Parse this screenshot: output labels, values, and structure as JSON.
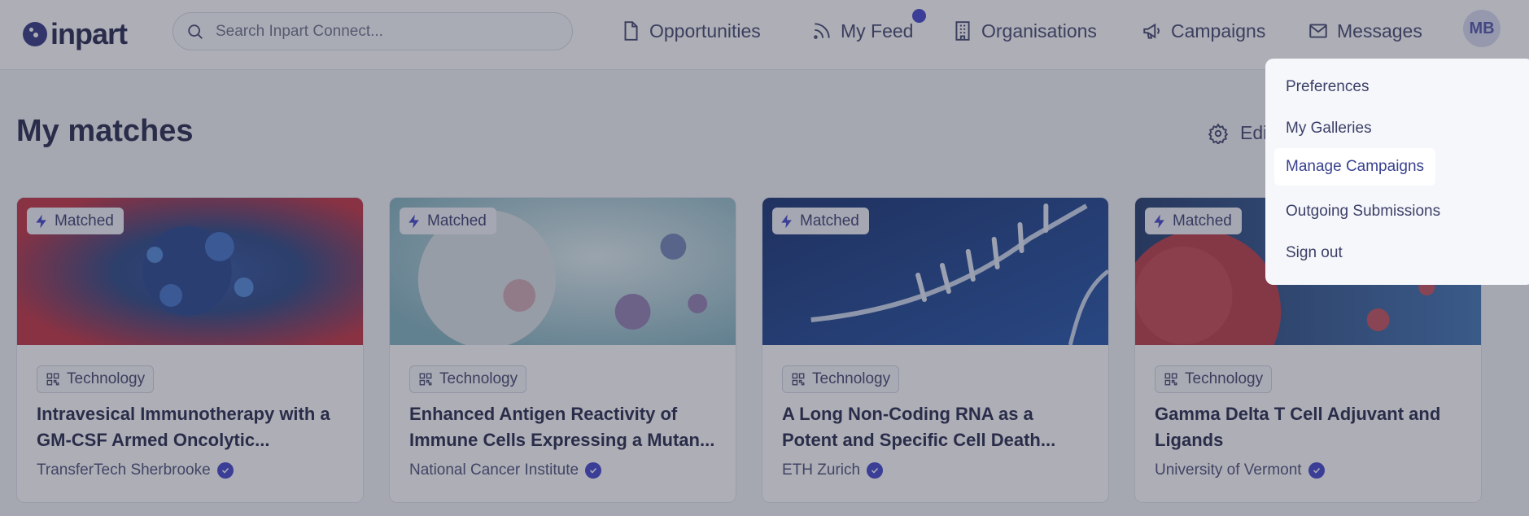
{
  "header": {
    "logo_text": "inpart",
    "search_placeholder": "Search Inpart Connect...",
    "nav": [
      {
        "label": "Opportunities",
        "icon": "document-icon"
      },
      {
        "label": "My Feed",
        "icon": "rss-icon",
        "has_notification_dot": true
      },
      {
        "label": "Organisations",
        "icon": "building-icon"
      },
      {
        "label": "Campaigns",
        "icon": "megaphone-icon"
      },
      {
        "label": "Messages",
        "icon": "envelope-icon"
      }
    ],
    "avatar_initials": "MB"
  },
  "page": {
    "title": "My matches",
    "edit_label": "Edi"
  },
  "menu": {
    "items": [
      {
        "label": "Preferences"
      },
      {
        "label": "My Galleries"
      },
      {
        "label": "Manage Campaigns",
        "highlighted": true
      },
      {
        "label": "Outgoing Submissions"
      },
      {
        "label": "Sign out"
      }
    ]
  },
  "cards": [
    {
      "badge": "Matched",
      "tag": "Technology",
      "title": "Intravesical Immunotherapy with a GM-CSF Armed Oncolytic...",
      "org": "TransferTech Sherbrooke",
      "verified": true
    },
    {
      "badge": "Matched",
      "tag": "Technology",
      "title": "Enhanced Antigen Reactivity of Immune Cells Expressing a Mutan...",
      "org": "National Cancer Institute",
      "verified": true
    },
    {
      "badge": "Matched",
      "tag": "Technology",
      "title": "A Long Non-Coding RNA as a Potent and Specific Cell Death...",
      "org": "ETH Zurich",
      "verified": true
    },
    {
      "badge": "Matched",
      "tag": "Technology",
      "title": "Gamma Delta T Cell Adjuvant and Ligands",
      "org": "University of Vermont",
      "verified": true
    }
  ],
  "colors": {
    "accent": "#3c3fc9",
    "overlay": "#3c3e50",
    "text": "#1e2244"
  }
}
